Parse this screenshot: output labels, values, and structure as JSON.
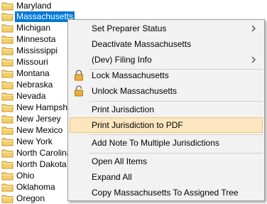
{
  "tree": {
    "items": [
      {
        "label": "Maryland",
        "selected": false
      },
      {
        "label": "Massachusetts",
        "selected": true
      },
      {
        "label": "Michigan",
        "selected": false
      },
      {
        "label": "Minnesota",
        "selected": false
      },
      {
        "label": "Mississippi",
        "selected": false
      },
      {
        "label": "Missouri",
        "selected": false
      },
      {
        "label": "Montana",
        "selected": false
      },
      {
        "label": "Nebraska",
        "selected": false
      },
      {
        "label": "Nevada",
        "selected": false
      },
      {
        "label": "New Hampshire",
        "selected": false
      },
      {
        "label": "New Jersey",
        "selected": false
      },
      {
        "label": "New Mexico",
        "selected": false
      },
      {
        "label": "New York",
        "selected": false
      },
      {
        "label": "North Carolina",
        "selected": false
      },
      {
        "label": "North Dakota",
        "selected": false
      },
      {
        "label": "Ohio",
        "selected": false
      },
      {
        "label": "Oklahoma",
        "selected": false
      },
      {
        "label": "Oregon",
        "selected": false
      }
    ]
  },
  "context_menu": {
    "items": [
      {
        "label": "Set Preparer Status",
        "submenu": true
      },
      {
        "label": "Deactivate Massachusetts"
      },
      {
        "label": "(Dev) Filing Info",
        "submenu": true
      },
      {
        "label": "Lock Massachusetts",
        "icon": "lock-closed-icon"
      },
      {
        "label": "Unlock Massachusetts",
        "icon": "lock-open-icon"
      },
      {
        "label": "Print Jurisdiction"
      },
      {
        "label": "Print Jurisdiction to PDF",
        "highlighted": true
      },
      {
        "label": "Add Note To Multiple Jurisdictions"
      },
      {
        "label": "Open All Items"
      },
      {
        "label": "Expand All"
      },
      {
        "label": "Copy Massachusetts To Assigned Tree"
      }
    ]
  },
  "colors": {
    "selection": "#0078d7",
    "menu_background": "#f2f2f2",
    "menu_hover": "#fbe6bf",
    "folder": "#f3cf6b"
  }
}
